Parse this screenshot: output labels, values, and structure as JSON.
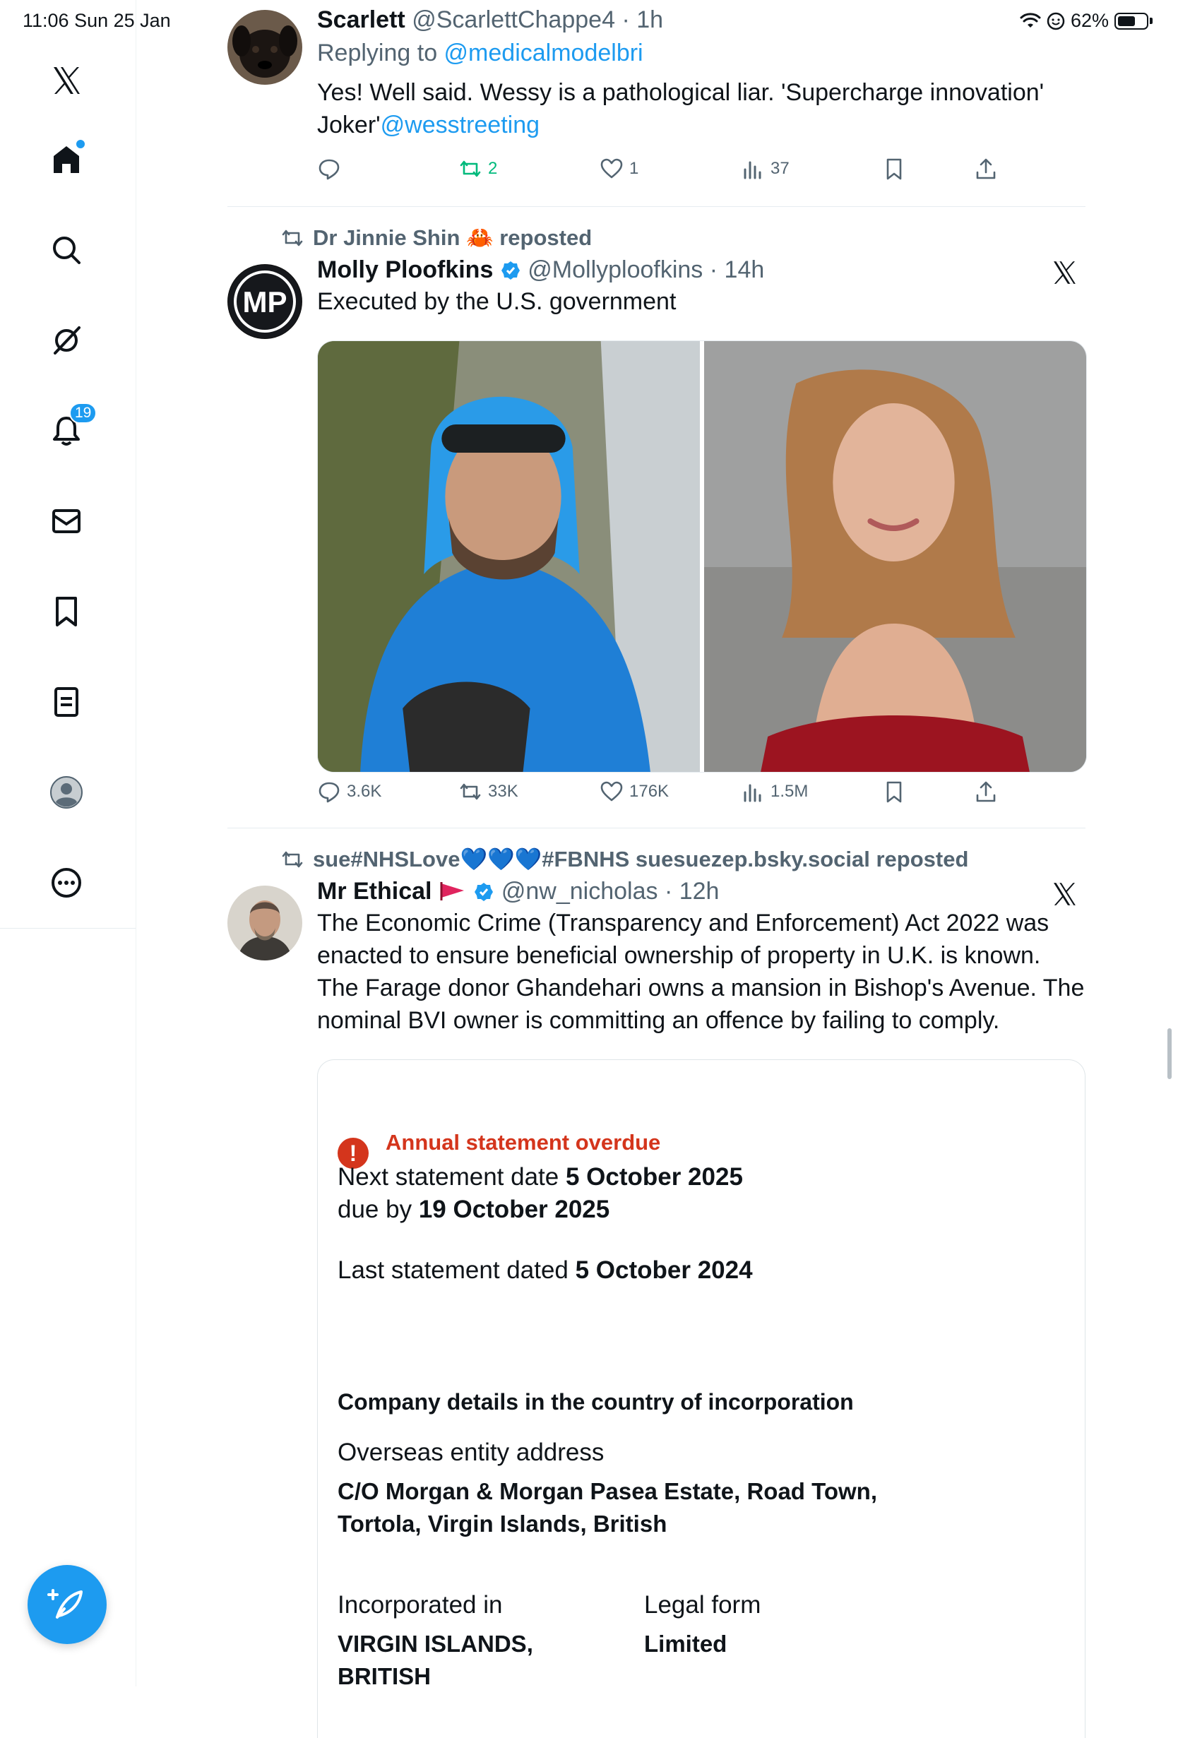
{
  "status_bar": {
    "time": "11:06  Sun 25 Jan",
    "battery": "62%",
    "battery_level": 0.62
  },
  "sidebar": {
    "items": [
      {
        "name": "x-logo",
        "icon": "x-logo-icon"
      },
      {
        "name": "home",
        "icon": "home-icon"
      },
      {
        "name": "search",
        "icon": "search-icon"
      },
      {
        "name": "grok",
        "icon": "grok-icon"
      },
      {
        "name": "notifications",
        "icon": "bell-icon",
        "badge": "19"
      },
      {
        "name": "messages",
        "icon": "envelope-icon"
      },
      {
        "name": "bookmarks",
        "icon": "bookmark-icon"
      },
      {
        "name": "lists",
        "icon": "list-icon"
      },
      {
        "name": "profile",
        "icon": "avatar-icon"
      },
      {
        "name": "more",
        "icon": "more-icon"
      }
    ],
    "compose_icon": "compose-feather-icon"
  },
  "posts": [
    {
      "name": "Scarlett",
      "handle": "@ScarlettChappe4",
      "time": "· 1h",
      "replying_prefix": "Replying to ",
      "replying_to": "@medicalmodelbri",
      "text": "Yes! Well said. Wessy is a pathological liar. 'Supercharge innovation' Joker'",
      "text_link": "@wesstreeting",
      "replies": "",
      "reposts": "2",
      "likes": "1",
      "views": "37"
    },
    {
      "repost_by": "Dr Jinnie Shin 🦀 reposted",
      "name": "Molly Ploofkins",
      "handle": "@Mollyploofkins",
      "time": "· 14h",
      "text": "Executed by the U.S. government",
      "avatar_initials": "MP",
      "replies": "3.6K",
      "reposts": "33K",
      "likes": "176K",
      "views": "1.5M"
    },
    {
      "repost_by": "sue#NHSLove💙💙💙#FBNHS suesuezep.bsky.social reposted",
      "name": "Mr Ethical",
      "handle": "@nw_nicholas",
      "time": "· 12h",
      "text": "The Economic Crime (Transparency and Enforcement) Act 2022 was enacted to ensure beneficial ownership of property in U.K. is known. The Farage donor Ghandehari owns a mansion in Bishop's Avenue. The nominal BVI owner is committing an offence by failing to comply.",
      "card": {
        "overdue": "Annual statement overdue",
        "next_label": "Next statement date ",
        "next_value": "5 October 2025",
        "due_label": "due by ",
        "due_value": "19 October 2025",
        "last_label": "Last statement dated ",
        "last_value": "5 October 2024",
        "section_title": "Company details in the country of incorporation",
        "address_label": "Overseas entity address",
        "address_line1": "C/O Morgan & Morgan Pasea Estate, Road Town,",
        "address_line2": "Tortola, Virgin Islands, British",
        "incorporated_label": "Incorporated in",
        "incorporated_line1": "VIRGIN ISLANDS,",
        "incorporated_line2": "BRITISH",
        "legal_form_label": "Legal form",
        "legal_form_value": "Limited"
      }
    }
  ]
}
